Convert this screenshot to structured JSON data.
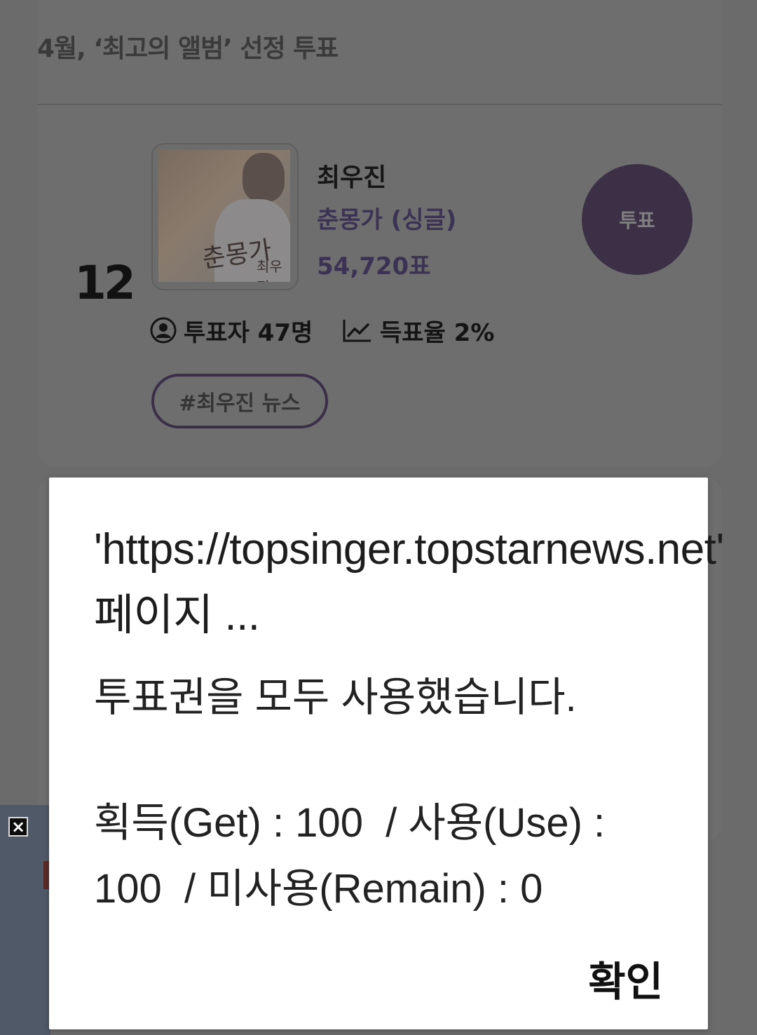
{
  "page": {
    "section_title": "4월, ‘최고의 앨범’ 선정 투표"
  },
  "entry": {
    "rank": "12",
    "artist": "최우진",
    "album": "춘몽가 (싱글)",
    "votes": "54,720표",
    "vote_button_label": "투표",
    "voters_label": "투표자 47명",
    "vote_rate_label": "득표율 2%",
    "tag_label": "#최우진 뉴스",
    "album_art_text": "춘몽가",
    "album_art_subtext": "최우진"
  },
  "ad": {
    "close_label": "×"
  },
  "dialog": {
    "title": "'https://topsinger.topstarnews.net' 페이지 ...",
    "message": "투표권을 모두 사용했습니다.",
    "stats": "획득(Get) : 100  / 사용(Use) : 100  / 미사용(Remain) : 0",
    "confirm_label": "확인"
  },
  "icons": {
    "user": "user-circle-icon",
    "trend": "trend-up-icon"
  },
  "colors": {
    "accent": "#3c3046",
    "overlay": "#6b6b6b",
    "dialog_bg": "#ffffff"
  }
}
